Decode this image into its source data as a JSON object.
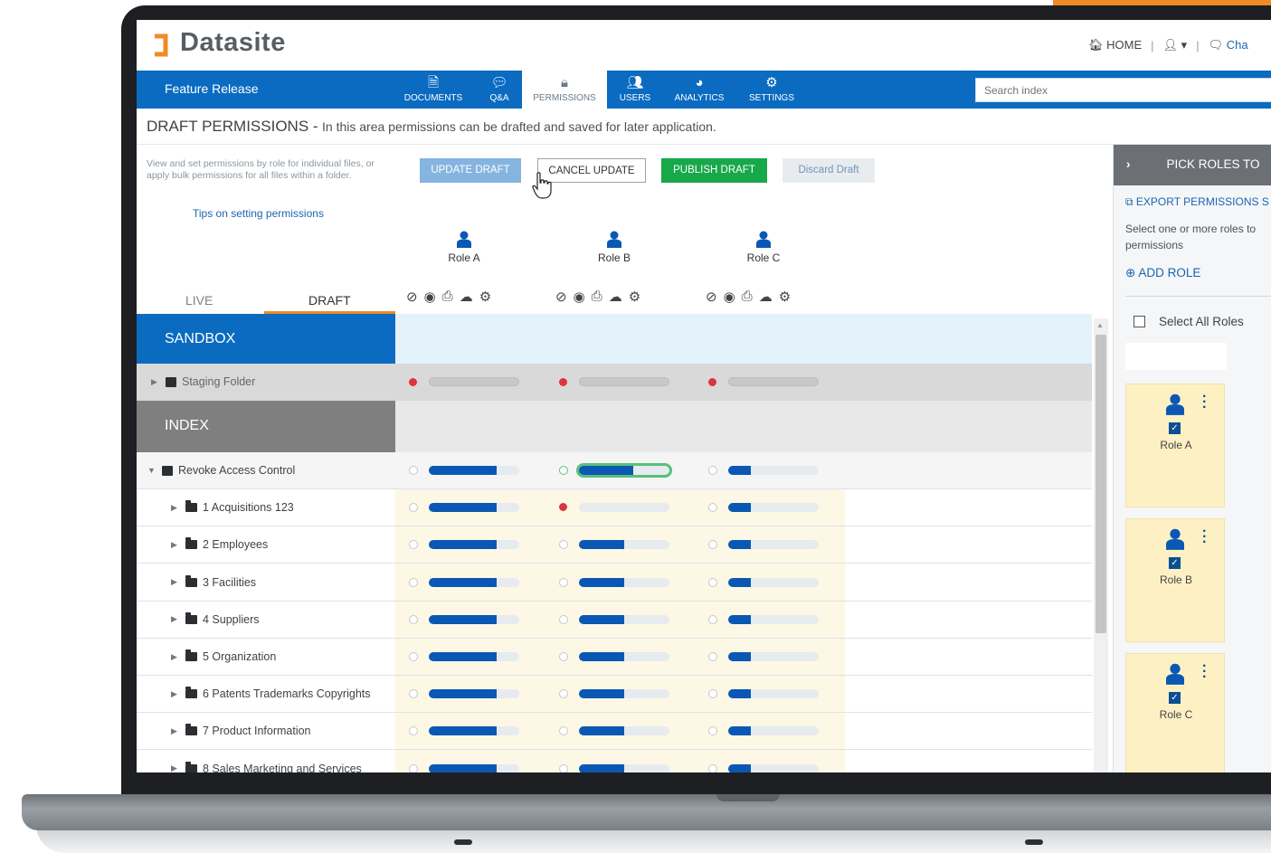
{
  "header": {
    "logo_text": "Datasite",
    "home_label": "HOME",
    "chat_label": "Cha",
    "brand_color": "#f08a24"
  },
  "navbar": {
    "app_title": "Feature Release",
    "tabs": [
      {
        "label": "DOCUMENTS",
        "icon": "document-icon"
      },
      {
        "label": "Q&A",
        "icon": "chat-bubbles-icon"
      },
      {
        "label": "PERMISSIONS",
        "icon": "lock-icon",
        "active": true
      },
      {
        "label": "USERS",
        "icon": "users-icon"
      },
      {
        "label": "ANALYTICS",
        "icon": "pie-chart-icon"
      },
      {
        "label": "SETTINGS",
        "icon": "gear-icon"
      }
    ],
    "search_placeholder": "Search index",
    "accent_color": "#0a6bc0"
  },
  "page": {
    "title": "DRAFT PERMISSIONS",
    "title_separator": "-",
    "description": "In this area permissions can be drafted and saved for later application.",
    "help_text": "View and set permissions by role for individual files, or apply bulk permissions for all files within a folder.",
    "tips_link": "Tips on setting permissions"
  },
  "actions": {
    "update_draft": "UPDATE DRAFT",
    "cancel_update": "CANCEL UPDATE",
    "publish_draft": "PUBLISH DRAFT",
    "discard_draft": "Discard Draft"
  },
  "view_toggle": {
    "live": "LIVE",
    "draft": "DRAFT",
    "selected": "DRAFT"
  },
  "roles": [
    "Role A",
    "Role B",
    "Role C"
  ],
  "permission_icons": [
    "eye-slash-icon",
    "eye-icon",
    "print-icon",
    "cloud-download-icon",
    "cogs-icon"
  ],
  "sections": {
    "sandbox": "SANDBOX",
    "index": "INDEX"
  },
  "staging": {
    "label": "Staging Folder",
    "levels": [
      "none",
      "none",
      "none"
    ]
  },
  "index_rows": [
    {
      "label": "Revoke Access Control",
      "type": "root",
      "levels": [
        0.75,
        0.6,
        0.25
      ]
    },
    {
      "label": "1 Acquisitions 123",
      "type": "folder",
      "levels": [
        0.75,
        0,
        0.25
      ]
    },
    {
      "label": "2 Employees",
      "type": "folder",
      "levels": [
        0.75,
        0.5,
        0.25
      ]
    },
    {
      "label": "3 Facilities",
      "type": "folder",
      "levels": [
        0.75,
        0.5,
        0.25
      ]
    },
    {
      "label": "4 Suppliers",
      "type": "folder",
      "levels": [
        0.75,
        0.5,
        0.25
      ]
    },
    {
      "label": "5 Organization",
      "type": "folder",
      "levels": [
        0.75,
        0.5,
        0.25
      ]
    },
    {
      "label": "6 Patents Trademarks Copyrights",
      "type": "folder",
      "levels": [
        0.75,
        0.5,
        0.25
      ]
    },
    {
      "label": "7 Product Information",
      "type": "folder",
      "levels": [
        0.75,
        0.5,
        0.25
      ]
    },
    {
      "label": "8 Sales Marketing and Services",
      "type": "folder",
      "levels": [
        0.75,
        0.5,
        0.25
      ]
    }
  ],
  "right_panel": {
    "title": "PICK ROLES TO",
    "export_link": "EXPORT PERMISSIONS S",
    "description": "Select one or more roles to permissions",
    "add_role": "ADD ROLE",
    "select_all": "Select All Roles",
    "role_cards": [
      "Role A",
      "Role B",
      "Role C"
    ]
  }
}
